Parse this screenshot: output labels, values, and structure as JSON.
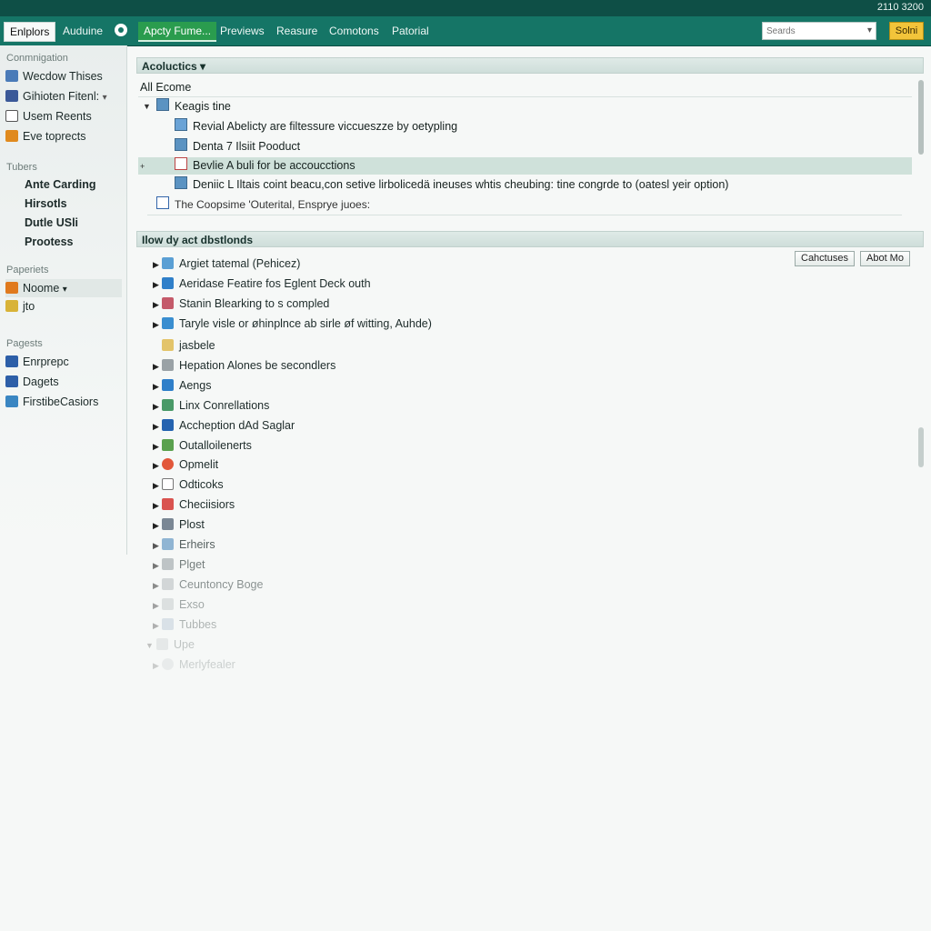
{
  "clock": "2110 3200",
  "toolbar": {
    "items": [
      "Enlplors",
      "Auduine",
      "Apcty Fume...",
      "Previews",
      "Reasure",
      "Comotons",
      "Patorial"
    ],
    "search_placeholder": "Seards",
    "solve_label": "Solni"
  },
  "sidebar": {
    "head1": "Conmnigation",
    "items1": [
      "Wecdow Thises",
      "Gihioten Fitenl:",
      "Usem Reents",
      "Eve toprects"
    ],
    "head2": "Tubers",
    "subitems": [
      "Ante Carding",
      "Hirsotls",
      "Dutle USli",
      "Prootess"
    ],
    "head3": "Paperiets",
    "items3": [
      "Noome",
      "jto"
    ],
    "head4": "Pagests",
    "items4": [
      "Enrprepc",
      "Dagets",
      "FirstibeCasiors"
    ]
  },
  "panel1": {
    "title": "Acoluctics",
    "all_label": "All Ecome",
    "group": "Keagis tine",
    "rows": [
      "Revial Abelicty are filtessure viccueszze by oetypling",
      "Denta 7 Ilsiit Pooduct",
      "Bevlie A buli for be accoucctions",
      "Deniic L Iltais coint beacu,con setive lirbolicedä ineuses whtis cheubing: tine congrde to (oatesl yeir option)"
    ],
    "footer": "The Coopsime 'Outerital, Ensprye juoes:"
  },
  "panel2": {
    "title": "Ilow dy act dbstlonds",
    "btn1": "Cahctuses",
    "btn2": "Abot Mo",
    "items": [
      "Argiet tatemal (Pehicez)",
      "Aeridase Featire fos Eglent Deck outh",
      "Stanin Blearking to s compled",
      "Taryle visle or øhinplnce ab sirle øf witting, Auhde)",
      "jasbele",
      "Hepation Alones be secondlers",
      "Aengs",
      "Linx Conrellations",
      "Accheption dAd Saglar",
      "Outalloilenerts",
      "Opmelit",
      "Odticoks",
      "Checiisiors",
      "Plost",
      "Erheirs",
      "Plget",
      "Ceuntoncy Boge",
      "Exso",
      "Tubbes",
      "Upe",
      "Merlyfealer"
    ]
  },
  "colors": {
    "toolbar": "#157566",
    "accent": "#2a9c4e",
    "highlight": "#cfe1da",
    "solve": "#f2c43a"
  }
}
